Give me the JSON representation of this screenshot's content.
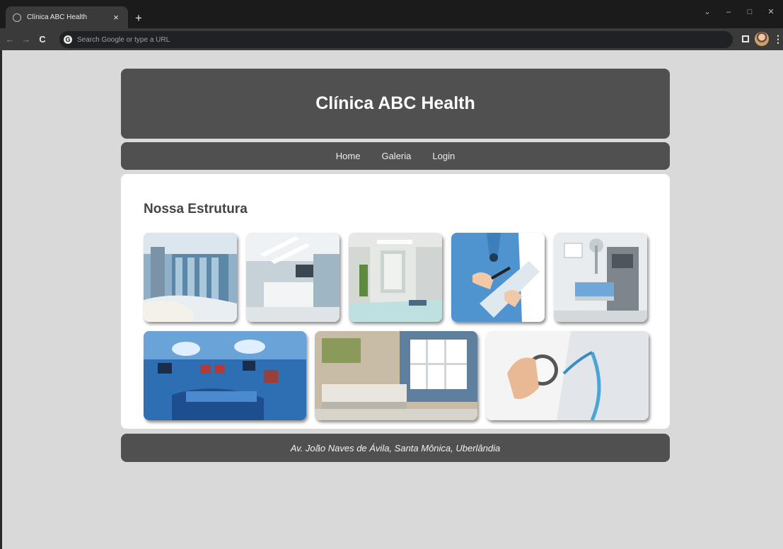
{
  "browser": {
    "tab_title": "Clínica ABC Health",
    "close_glyph": "×",
    "newtab_glyph": "+",
    "back_glyph": "←",
    "forward_glyph": "→",
    "reload_glyph": "C",
    "search_placeholder": "Search Google or type a URL",
    "google_glyph": "G",
    "menu_glyph": "⋮",
    "window_controls": [
      "⌄",
      "–",
      "□",
      "✕"
    ]
  },
  "header": {
    "title": "Clínica ABC Health"
  },
  "nav": {
    "items": [
      "Home",
      "Galeria",
      "Login"
    ]
  },
  "gallery": {
    "heading": "Nossa Estrutura",
    "images": [
      "reception-hall",
      "reception-desk",
      "clinic-hallway",
      "nurse-clipboard",
      "hospital-room",
      "operating-room",
      "exam-room",
      "doctor-stethoscope"
    ]
  },
  "footer": {
    "address": "Av. João Naves de Ávila, Santa Mônica, Uberlândia"
  },
  "colors": {
    "page_bg": "#d9d9d9",
    "panel": "#505050",
    "content_bg": "#ffffff"
  }
}
